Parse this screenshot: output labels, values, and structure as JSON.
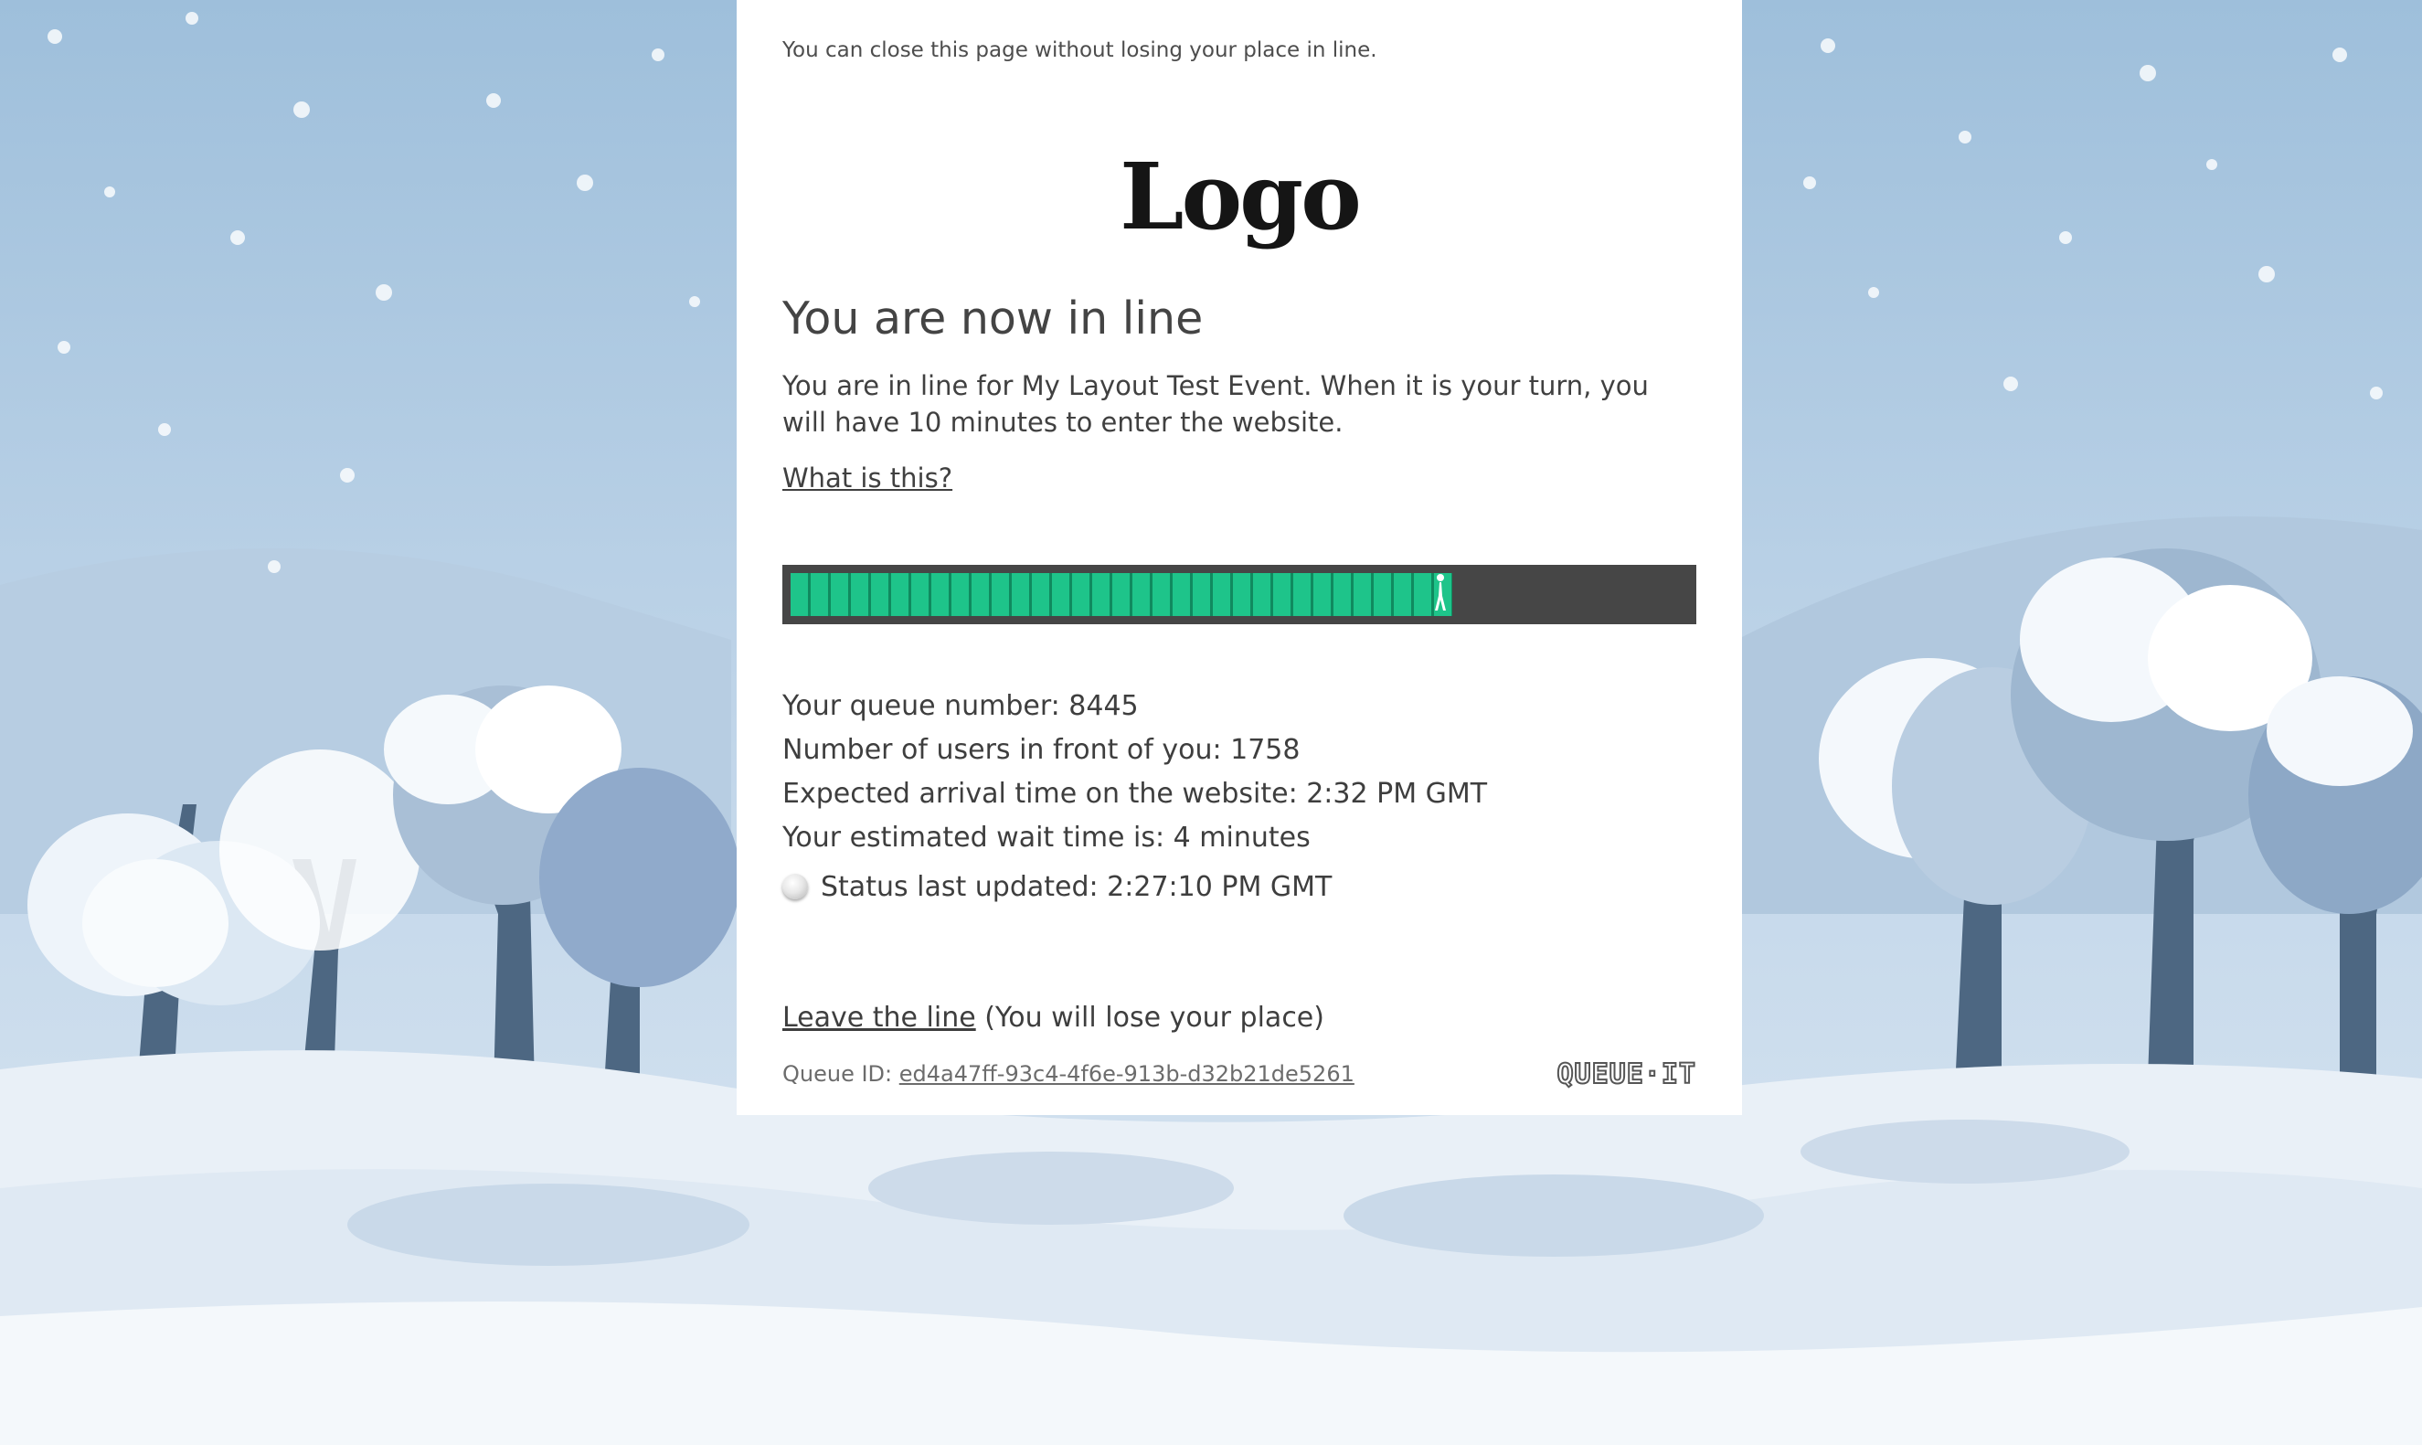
{
  "page": {
    "top_note": "You can close this page without losing your place in line.",
    "logo_text": "Logo",
    "heading": "You are now in line",
    "intro": "You are in line for My Layout Test Event. When it is your turn, you will have 10 minutes to enter the website.",
    "what_link": "What is this?"
  },
  "progress": {
    "fraction": 0.737,
    "segments": 33,
    "fill_color": "#1ec48a",
    "track_color": "#464646"
  },
  "queue_info": {
    "queue_number": "Your queue number: 8445",
    "users_ahead": "Number of users in front of you: 1758",
    "expected_arrival": "Expected arrival time on the website: 2:32 PM GMT",
    "wait_time": "Your estimated wait time is: 4 minutes",
    "status_updated": "Status last updated: 2:27:10 PM GMT"
  },
  "leave": {
    "link_label": "Leave the line",
    "note": " (You will lose your place)"
  },
  "footer": {
    "queue_id_label": "Queue ID: ",
    "queue_id_value": "ed4a47ff-93c4-4f6e-913b-d32b21de5261",
    "brand": "QUEUE·IT"
  },
  "icons": {
    "status": "spinner-icon",
    "walker": "walking-person-icon"
  }
}
